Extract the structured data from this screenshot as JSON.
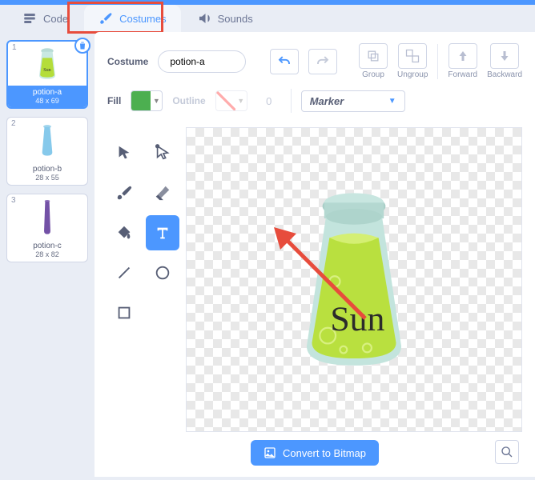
{
  "tabs": {
    "code": "Code",
    "costumes": "Costumes",
    "sounds": "Sounds"
  },
  "costume": {
    "label": "Costume",
    "name": "potion-a",
    "fillLabel": "Fill",
    "outlineLabel": "Outline",
    "outlineWidth": "0",
    "groupLabel": "Group",
    "ungroupLabel": "Ungroup",
    "forwardLabel": "Forward",
    "backwardLabel": "Backward",
    "font": "Marker",
    "potionText": "Sun"
  },
  "thumbs": [
    {
      "num": "1",
      "name": "potion-a",
      "dim": "48 x 69",
      "selected": true
    },
    {
      "num": "2",
      "name": "potion-b",
      "dim": "28 x 55",
      "selected": false
    },
    {
      "num": "3",
      "name": "potion-c",
      "dim": "28 x 82",
      "selected": false
    }
  ],
  "footer": {
    "convert": "Convert to Bitmap"
  },
  "colors": {
    "fill": "#4caf50"
  }
}
